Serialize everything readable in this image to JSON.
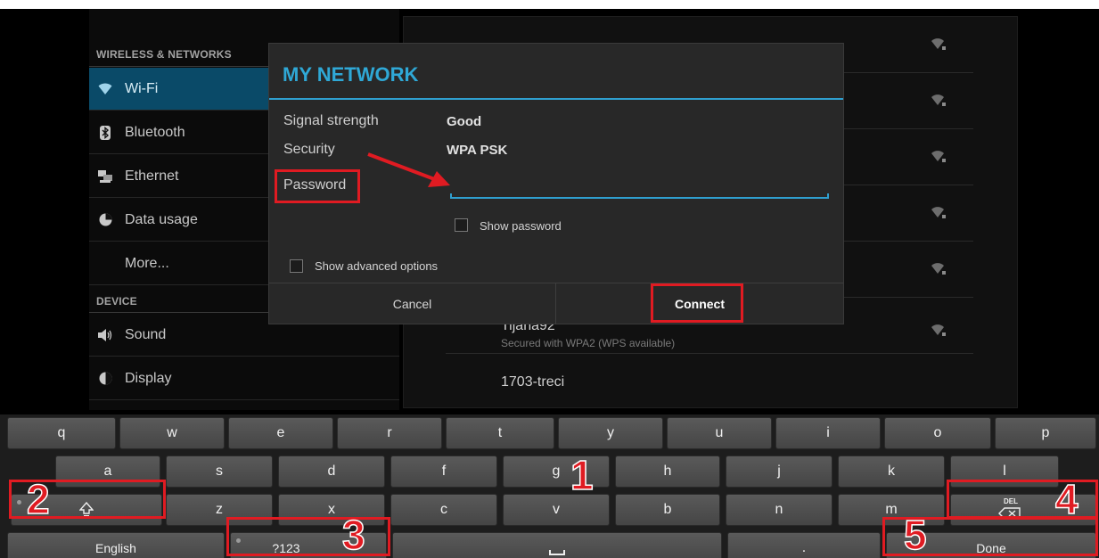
{
  "settings": {
    "wireless_header": "WIRELESS & NETWORKS",
    "device_header": "DEVICE",
    "items": [
      {
        "label": "Wi-Fi"
      },
      {
        "label": "Bluetooth"
      },
      {
        "label": "Ethernet"
      },
      {
        "label": "Data usage"
      },
      {
        "label": "More..."
      },
      {
        "label": "Sound"
      },
      {
        "label": "Display"
      }
    ]
  },
  "networks": [
    {
      "name": "Tijana92",
      "status": "Secured with WPA2 (WPS available)"
    },
    {
      "name": "1703-treci",
      "status": ""
    }
  ],
  "dialog": {
    "title": "MY NETWORK",
    "signal_label": "Signal strength",
    "signal_value": "Good",
    "security_label": "Security",
    "security_value": "WPA PSK",
    "password_label": "Password",
    "password_value": "",
    "show_password": "Show password",
    "show_advanced": "Show advanced options",
    "cancel": "Cancel",
    "connect": "Connect"
  },
  "annotations": [
    "1",
    "2",
    "3",
    "4",
    "5"
  ],
  "keyboard": {
    "row1": [
      "q",
      "w",
      "e",
      "r",
      "t",
      "y",
      "u",
      "i",
      "o",
      "p"
    ],
    "row2": [
      "a",
      "s",
      "d",
      "f",
      "g",
      "h",
      "j",
      "k",
      "l"
    ],
    "row3": [
      "z",
      "x",
      "c",
      "v",
      "b",
      "n",
      "m"
    ],
    "shift_icon": "shift-icon",
    "delete_icon": "delete-icon",
    "delete_label": "DEL",
    "language": "English",
    "symbols": "?123",
    "period": ".",
    "done": "Done"
  },
  "colors": {
    "accent": "#2fa8d6",
    "annotation": "#e01b22",
    "selected_item": "#0a4a68"
  }
}
